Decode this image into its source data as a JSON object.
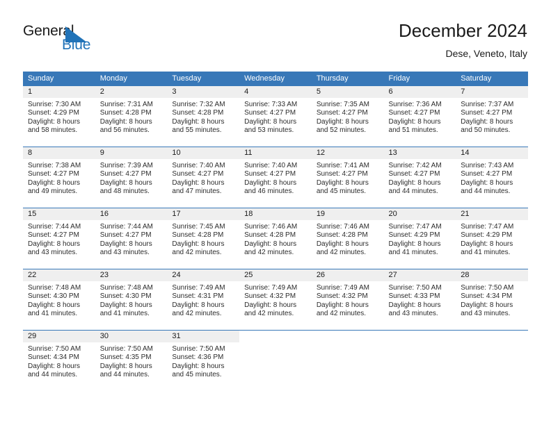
{
  "brand": {
    "name_part1": "General",
    "name_part2": "Blue",
    "mark": "triangle-flag-icon",
    "accent_color": "#2173b8"
  },
  "header": {
    "title": "December 2024",
    "subtitle": "Dese, Veneto, Italy"
  },
  "colors": {
    "header_blue": "#3878b8",
    "daynum_band": "#efefef",
    "row_rule": "#3878b8",
    "text": "#1a1a1a"
  },
  "calendar": {
    "weekdays": [
      "Sunday",
      "Monday",
      "Tuesday",
      "Wednesday",
      "Thursday",
      "Friday",
      "Saturday"
    ],
    "weeks": [
      [
        {
          "day": "1",
          "sunrise": "Sunrise: 7:30 AM",
          "sunset": "Sunset: 4:29 PM",
          "daylight1": "Daylight: 8 hours",
          "daylight2": "and 58 minutes."
        },
        {
          "day": "2",
          "sunrise": "Sunrise: 7:31 AM",
          "sunset": "Sunset: 4:28 PM",
          "daylight1": "Daylight: 8 hours",
          "daylight2": "and 56 minutes."
        },
        {
          "day": "3",
          "sunrise": "Sunrise: 7:32 AM",
          "sunset": "Sunset: 4:28 PM",
          "daylight1": "Daylight: 8 hours",
          "daylight2": "and 55 minutes."
        },
        {
          "day": "4",
          "sunrise": "Sunrise: 7:33 AM",
          "sunset": "Sunset: 4:27 PM",
          "daylight1": "Daylight: 8 hours",
          "daylight2": "and 53 minutes."
        },
        {
          "day": "5",
          "sunrise": "Sunrise: 7:35 AM",
          "sunset": "Sunset: 4:27 PM",
          "daylight1": "Daylight: 8 hours",
          "daylight2": "and 52 minutes."
        },
        {
          "day": "6",
          "sunrise": "Sunrise: 7:36 AM",
          "sunset": "Sunset: 4:27 PM",
          "daylight1": "Daylight: 8 hours",
          "daylight2": "and 51 minutes."
        },
        {
          "day": "7",
          "sunrise": "Sunrise: 7:37 AM",
          "sunset": "Sunset: 4:27 PM",
          "daylight1": "Daylight: 8 hours",
          "daylight2": "and 50 minutes."
        }
      ],
      [
        {
          "day": "8",
          "sunrise": "Sunrise: 7:38 AM",
          "sunset": "Sunset: 4:27 PM",
          "daylight1": "Daylight: 8 hours",
          "daylight2": "and 49 minutes."
        },
        {
          "day": "9",
          "sunrise": "Sunrise: 7:39 AM",
          "sunset": "Sunset: 4:27 PM",
          "daylight1": "Daylight: 8 hours",
          "daylight2": "and 48 minutes."
        },
        {
          "day": "10",
          "sunrise": "Sunrise: 7:40 AM",
          "sunset": "Sunset: 4:27 PM",
          "daylight1": "Daylight: 8 hours",
          "daylight2": "and 47 minutes."
        },
        {
          "day": "11",
          "sunrise": "Sunrise: 7:40 AM",
          "sunset": "Sunset: 4:27 PM",
          "daylight1": "Daylight: 8 hours",
          "daylight2": "and 46 minutes."
        },
        {
          "day": "12",
          "sunrise": "Sunrise: 7:41 AM",
          "sunset": "Sunset: 4:27 PM",
          "daylight1": "Daylight: 8 hours",
          "daylight2": "and 45 minutes."
        },
        {
          "day": "13",
          "sunrise": "Sunrise: 7:42 AM",
          "sunset": "Sunset: 4:27 PM",
          "daylight1": "Daylight: 8 hours",
          "daylight2": "and 44 minutes."
        },
        {
          "day": "14",
          "sunrise": "Sunrise: 7:43 AM",
          "sunset": "Sunset: 4:27 PM",
          "daylight1": "Daylight: 8 hours",
          "daylight2": "and 44 minutes."
        }
      ],
      [
        {
          "day": "15",
          "sunrise": "Sunrise: 7:44 AM",
          "sunset": "Sunset: 4:27 PM",
          "daylight1": "Daylight: 8 hours",
          "daylight2": "and 43 minutes."
        },
        {
          "day": "16",
          "sunrise": "Sunrise: 7:44 AM",
          "sunset": "Sunset: 4:27 PM",
          "daylight1": "Daylight: 8 hours",
          "daylight2": "and 43 minutes."
        },
        {
          "day": "17",
          "sunrise": "Sunrise: 7:45 AM",
          "sunset": "Sunset: 4:28 PM",
          "daylight1": "Daylight: 8 hours",
          "daylight2": "and 42 minutes."
        },
        {
          "day": "18",
          "sunrise": "Sunrise: 7:46 AM",
          "sunset": "Sunset: 4:28 PM",
          "daylight1": "Daylight: 8 hours",
          "daylight2": "and 42 minutes."
        },
        {
          "day": "19",
          "sunrise": "Sunrise: 7:46 AM",
          "sunset": "Sunset: 4:28 PM",
          "daylight1": "Daylight: 8 hours",
          "daylight2": "and 42 minutes."
        },
        {
          "day": "20",
          "sunrise": "Sunrise: 7:47 AM",
          "sunset": "Sunset: 4:29 PM",
          "daylight1": "Daylight: 8 hours",
          "daylight2": "and 41 minutes."
        },
        {
          "day": "21",
          "sunrise": "Sunrise: 7:47 AM",
          "sunset": "Sunset: 4:29 PM",
          "daylight1": "Daylight: 8 hours",
          "daylight2": "and 41 minutes."
        }
      ],
      [
        {
          "day": "22",
          "sunrise": "Sunrise: 7:48 AM",
          "sunset": "Sunset: 4:30 PM",
          "daylight1": "Daylight: 8 hours",
          "daylight2": "and 41 minutes."
        },
        {
          "day": "23",
          "sunrise": "Sunrise: 7:48 AM",
          "sunset": "Sunset: 4:30 PM",
          "daylight1": "Daylight: 8 hours",
          "daylight2": "and 41 minutes."
        },
        {
          "day": "24",
          "sunrise": "Sunrise: 7:49 AM",
          "sunset": "Sunset: 4:31 PM",
          "daylight1": "Daylight: 8 hours",
          "daylight2": "and 42 minutes."
        },
        {
          "day": "25",
          "sunrise": "Sunrise: 7:49 AM",
          "sunset": "Sunset: 4:32 PM",
          "daylight1": "Daylight: 8 hours",
          "daylight2": "and 42 minutes."
        },
        {
          "day": "26",
          "sunrise": "Sunrise: 7:49 AM",
          "sunset": "Sunset: 4:32 PM",
          "daylight1": "Daylight: 8 hours",
          "daylight2": "and 42 minutes."
        },
        {
          "day": "27",
          "sunrise": "Sunrise: 7:50 AM",
          "sunset": "Sunset: 4:33 PM",
          "daylight1": "Daylight: 8 hours",
          "daylight2": "and 43 minutes."
        },
        {
          "day": "28",
          "sunrise": "Sunrise: 7:50 AM",
          "sunset": "Sunset: 4:34 PM",
          "daylight1": "Daylight: 8 hours",
          "daylight2": "and 43 minutes."
        }
      ],
      [
        {
          "day": "29",
          "sunrise": "Sunrise: 7:50 AM",
          "sunset": "Sunset: 4:34 PM",
          "daylight1": "Daylight: 8 hours",
          "daylight2": "and 44 minutes."
        },
        {
          "day": "30",
          "sunrise": "Sunrise: 7:50 AM",
          "sunset": "Sunset: 4:35 PM",
          "daylight1": "Daylight: 8 hours",
          "daylight2": "and 44 minutes."
        },
        {
          "day": "31",
          "sunrise": "Sunrise: 7:50 AM",
          "sunset": "Sunset: 4:36 PM",
          "daylight1": "Daylight: 8 hours",
          "daylight2": "and 45 minutes."
        },
        {
          "day": "",
          "sunrise": "",
          "sunset": "",
          "daylight1": "",
          "daylight2": ""
        },
        {
          "day": "",
          "sunrise": "",
          "sunset": "",
          "daylight1": "",
          "daylight2": ""
        },
        {
          "day": "",
          "sunrise": "",
          "sunset": "",
          "daylight1": "",
          "daylight2": ""
        },
        {
          "day": "",
          "sunrise": "",
          "sunset": "",
          "daylight1": "",
          "daylight2": ""
        }
      ]
    ]
  }
}
